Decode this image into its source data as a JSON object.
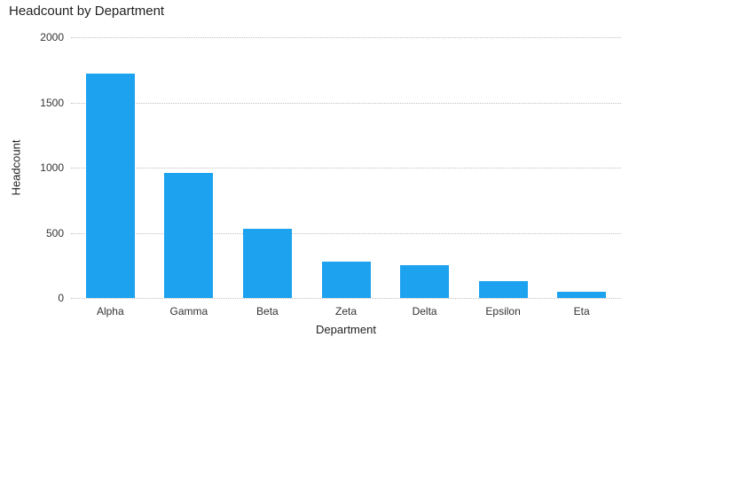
{
  "chart_data": {
    "type": "bar",
    "title": "Headcount by Department",
    "xlabel": "Department",
    "ylabel": "Headcount",
    "categories": [
      "Alpha",
      "Gamma",
      "Beta",
      "Zeta",
      "Delta",
      "Epsilon",
      "Eta"
    ],
    "values": [
      1720,
      960,
      530,
      280,
      250,
      130,
      50
    ],
    "y_ticks": [
      0,
      500,
      1000,
      1500,
      2000
    ],
    "ylim": [
      0,
      2000
    ],
    "bar_color": "#1ca2ef",
    "grid": true
  }
}
